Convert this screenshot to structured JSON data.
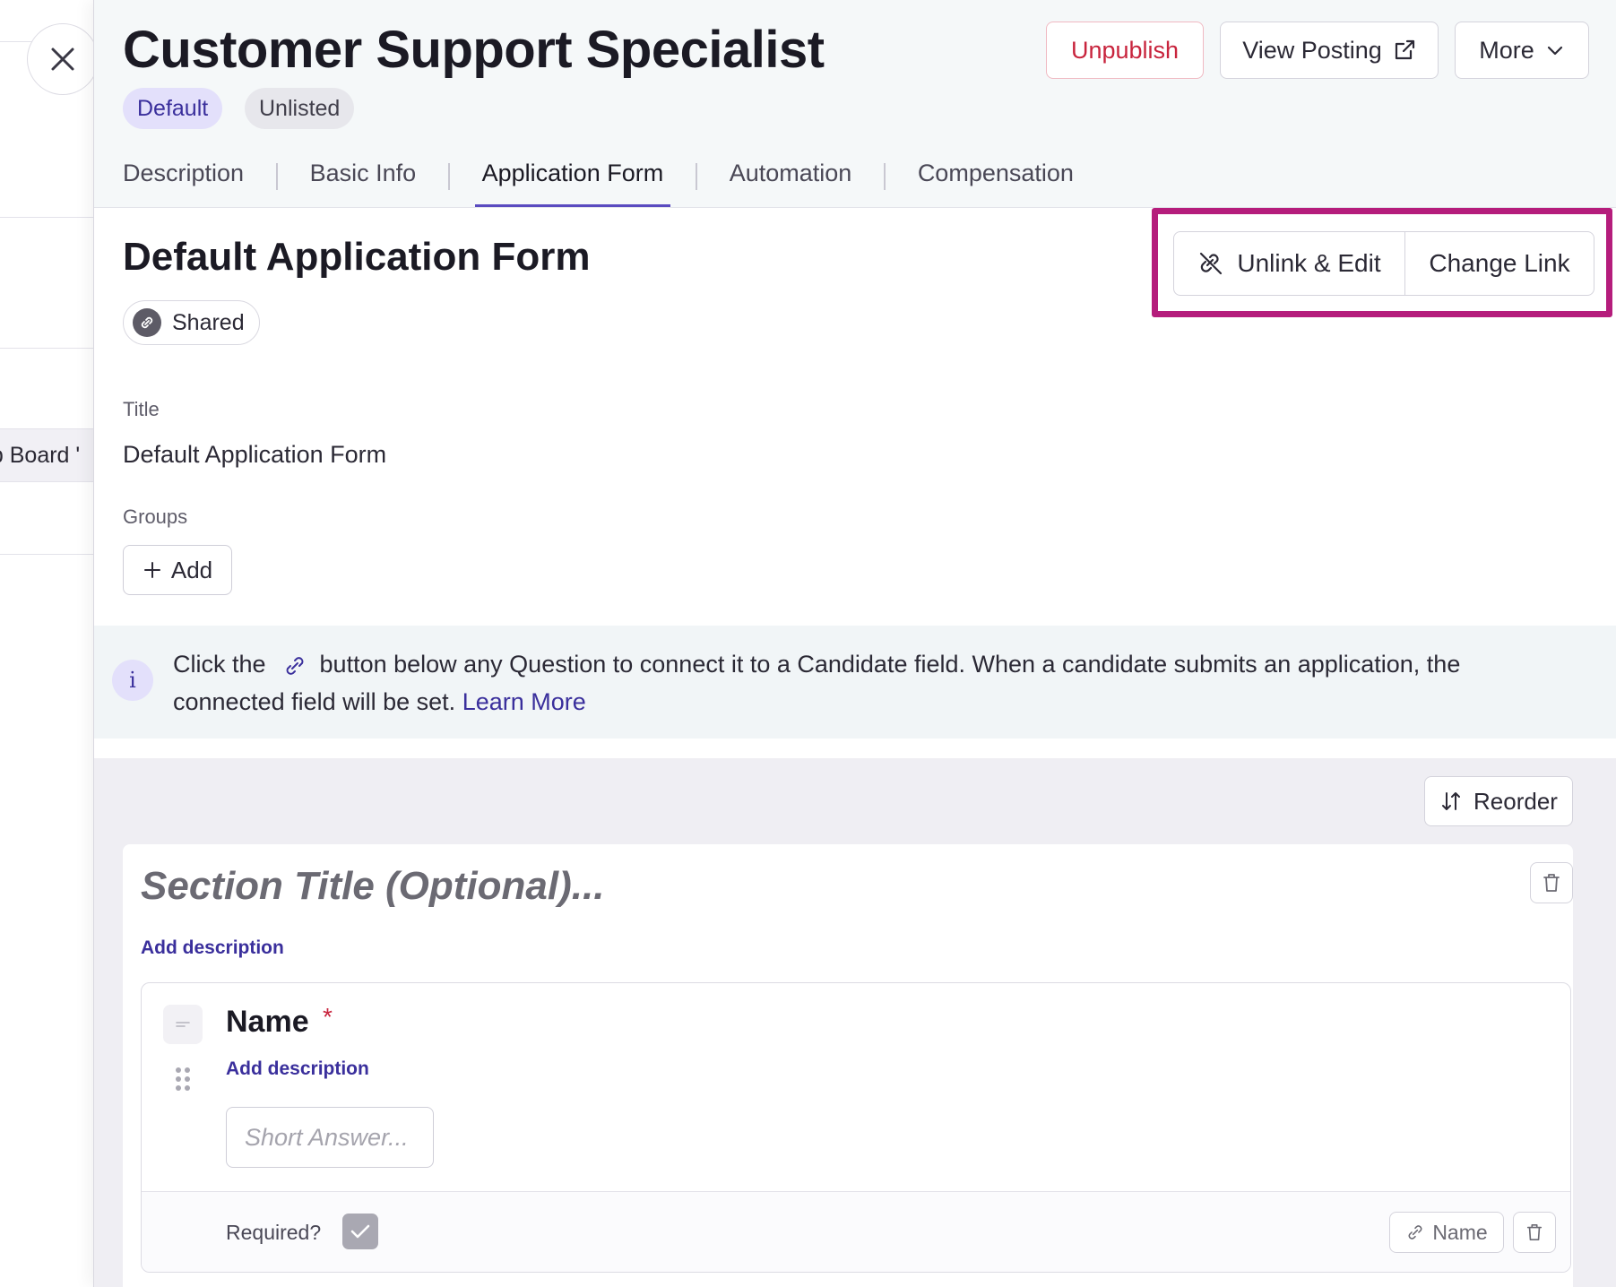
{
  "page": {
    "job_title": "Customer Support Specialist",
    "tags": [
      "Default",
      "Unlisted"
    ]
  },
  "background": {
    "row_label": "ob Board '"
  },
  "header_actions": {
    "unpublish": "Unpublish",
    "view_posting": "View Posting",
    "more": "More"
  },
  "tabs": [
    {
      "label": "Description",
      "active": false
    },
    {
      "label": "Basic Info",
      "active": false
    },
    {
      "label": "Application Form",
      "active": true
    },
    {
      "label": "Automation",
      "active": false
    },
    {
      "label": "Compensation",
      "active": false
    }
  ],
  "form": {
    "heading": "Default Application Form",
    "shared_label": "Shared",
    "unlink_edit": "Unlink & Edit",
    "change_link": "Change Link",
    "title_label": "Title",
    "title_value": "Default Application Form",
    "groups_label": "Groups",
    "add_label": "Add"
  },
  "info": {
    "text_before": "Click the",
    "text_after": "button below any Question to connect it to a Candidate field. When a candidate submits an application, the connected field will be set.",
    "learn_more": "Learn More"
  },
  "builder": {
    "reorder": "Reorder",
    "section_title_placeholder": "Section Title (Optional)...",
    "add_description": "Add description",
    "question": {
      "title": "Name",
      "required_marker": "*",
      "add_description": "Add description",
      "answer_placeholder": "Short Answer...",
      "required_label": "Required?",
      "required_checked": true,
      "linked_field": "Name"
    }
  },
  "colors": {
    "accent": "#5a4bc0",
    "highlight": "#b51d7c",
    "danger": "#c8243d"
  }
}
